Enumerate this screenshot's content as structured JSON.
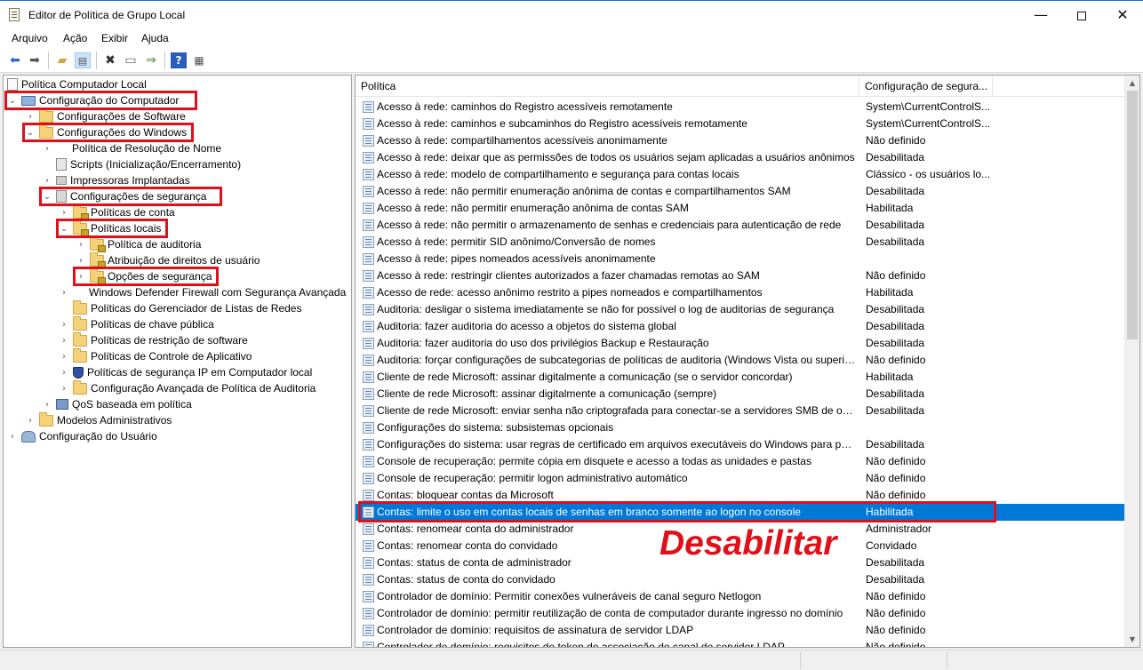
{
  "window": {
    "title": "Editor de Política de Grupo Local",
    "icon": "policy-document-icon"
  },
  "menu": [
    "Arquivo",
    "Ação",
    "Exibir",
    "Ajuda"
  ],
  "toolbar_icons": [
    "back-arrow-icon",
    "forward-arrow-icon",
    "up-folder-icon",
    "show-hide-tree-icon",
    "delete-icon",
    "properties-icon",
    "export-list-icon",
    "help-icon",
    "view-icon"
  ],
  "tree": [
    {
      "label": "Política Computador Local",
      "expander": "",
      "icon": "policy-icon"
    },
    {
      "label": "Configuração do Computador",
      "expander": "open",
      "icon": "computer-icon"
    },
    {
      "label": "Configurações de Software",
      "expander": "closed",
      "icon": "folder-icon"
    },
    {
      "label": "Configurações do Windows",
      "expander": "open",
      "icon": "folder-icon"
    },
    {
      "label": "Política de Resolução de Nome",
      "expander": "closed",
      "icon": ""
    },
    {
      "label": "Scripts (Inicialização/Encerramento)",
      "expander": "",
      "icon": "script-icon"
    },
    {
      "label": "Impressoras Implantadas",
      "expander": "closed",
      "icon": "printer-icon"
    },
    {
      "label": "Configurações de segurança",
      "expander": "open",
      "icon": "security-settings-icon"
    },
    {
      "label": "Políticas de conta",
      "expander": "closed",
      "icon": "lock-folder-icon"
    },
    {
      "label": "Políticas locais",
      "expander": "open",
      "icon": "lock-folder-icon"
    },
    {
      "label": "Política de auditoria",
      "expander": "closed",
      "icon": "lock-folder-icon"
    },
    {
      "label": "Atribuição de direitos de usuário",
      "expander": "closed",
      "icon": "lock-folder-icon"
    },
    {
      "label": "Opções de segurança",
      "expander": "closed",
      "icon": "lock-folder-icon"
    },
    {
      "label": "Windows Defender Firewall com Segurança Avançada",
      "expander": "closed",
      "icon": "firewall-icon"
    },
    {
      "label": "Políticas do Gerenciador de Listas de Redes",
      "expander": "",
      "icon": "folder-icon"
    },
    {
      "label": "Políticas de chave pública",
      "expander": "closed",
      "icon": "folder-icon"
    },
    {
      "label": "Políticas de restrição de software",
      "expander": "closed",
      "icon": "folder-icon"
    },
    {
      "label": "Políticas de Controle de Aplicativo",
      "expander": "closed",
      "icon": "folder-icon"
    },
    {
      "label": "Políticas de segurança IP em Computador local",
      "expander": "closed",
      "icon": "ip-security-icon"
    },
    {
      "label": "Configuração Avançada de Política de Auditoria",
      "expander": "closed",
      "icon": "folder-icon"
    },
    {
      "label": "QoS baseada em política",
      "expander": "closed",
      "icon": "qos-chart-icon"
    },
    {
      "label": "Modelos Administrativos",
      "expander": "closed",
      "icon": "folder-icon"
    },
    {
      "label": "Configuração do Usuário",
      "expander": "closed",
      "icon": "users-icon"
    }
  ],
  "list": {
    "columns": [
      "Política",
      "Configuração de segura..."
    ],
    "rows": [
      {
        "name": "Acesso à rede: caminhos do Registro acessíveis remotamente",
        "value": "System\\CurrentControlS..."
      },
      {
        "name": "Acesso à rede: caminhos e subcaminhos do Registro acessíveis remotamente",
        "value": "System\\CurrentControlS..."
      },
      {
        "name": "Acesso à rede: compartilhamentos acessíveis anonimamente",
        "value": "Não definido"
      },
      {
        "name": "Acesso à rede: deixar que as permissões de todos os usuários sejam aplicadas a usuários anônimos",
        "value": "Desabilitada"
      },
      {
        "name": "Acesso à rede: modelo de compartilhamento e segurança para contas locais",
        "value": "Clássico - os usuários lo..."
      },
      {
        "name": "Acesso à rede: não permitir enumeração anônima de contas e compartilhamentos SAM",
        "value": "Desabilitada"
      },
      {
        "name": "Acesso à rede: não permitir enumeração anônima de contas SAM",
        "value": "Habilitada"
      },
      {
        "name": "Acesso à rede: não permitir o armazenamento de senhas e credenciais para autenticação de rede",
        "value": "Desabilitada"
      },
      {
        "name": "Acesso à rede: permitir SID anônimo/Conversão de nomes",
        "value": "Desabilitada"
      },
      {
        "name": "Acesso à rede: pipes nomeados acessíveis anonimamente",
        "value": ""
      },
      {
        "name": "Acesso à rede: restringir clientes autorizados a fazer chamadas remotas ao SAM",
        "value": "Não definido"
      },
      {
        "name": "Acesso de rede: acesso anônimo restrito a pipes nomeados e compartilhamentos",
        "value": "Habilitada"
      },
      {
        "name": "Auditoria: desligar o sistema imediatamente se não for possível o log de auditorias de segurança",
        "value": "Desabilitada"
      },
      {
        "name": "Auditoria: fazer auditoria do acesso a objetos do sistema global",
        "value": "Desabilitada"
      },
      {
        "name": "Auditoria: fazer auditoria do uso dos privilégios Backup e Restauração",
        "value": "Desabilitada"
      },
      {
        "name": "Auditoria: forçar configurações de subcategorias de políticas de auditoria (Windows Vista ou superior...",
        "value": "Não definido"
      },
      {
        "name": "Cliente de rede Microsoft: assinar digitalmente a comunicação (se o servidor concordar)",
        "value": "Habilitada"
      },
      {
        "name": "Cliente de rede Microsoft: assinar digitalmente a comunicação (sempre)",
        "value": "Desabilitada"
      },
      {
        "name": "Cliente de rede Microsoft: enviar senha não criptografada para conectar-se a servidores SMB de outro...",
        "value": "Desabilitada"
      },
      {
        "name": "Configurações do sistema: subsistemas opcionais",
        "value": ""
      },
      {
        "name": "Configurações do sistema: usar regras de certificado em arquivos executáveis do Windows para políti...",
        "value": "Desabilitada"
      },
      {
        "name": "Console de recuperação: permite cópia em disquete e acesso a todas as unidades e pastas",
        "value": "Não definido"
      },
      {
        "name": "Console de recuperação: permitir logon administrativo automático",
        "value": "Não definido"
      },
      {
        "name": "Contas: bloquear contas da Microsoft",
        "value": "Não definido"
      },
      {
        "name": "Contas: limite o uso em contas locais de senhas em branco somente ao logon no console",
        "value": "Habilitada"
      },
      {
        "name": "Contas: renomear conta do administrador",
        "value": "Administrador"
      },
      {
        "name": "Contas: renomear conta do convidado",
        "value": "Convidado"
      },
      {
        "name": "Contas: status de conta de administrador",
        "value": "Desabilitada"
      },
      {
        "name": "Contas: status de conta do convidado",
        "value": "Desabilitada"
      },
      {
        "name": "Controlador de domínio: Permitir conexões vulneráveis de canal seguro Netlogon",
        "value": "Não definido"
      },
      {
        "name": "Controlador de domínio: permitir reutilização de conta de computador durante ingresso no domínio",
        "value": "Não definido"
      },
      {
        "name": "Controlador de domínio: requisitos de assinatura de servidor LDAP",
        "value": "Não definido"
      },
      {
        "name": "Controlador de domínio: requisitos de token de associação de canal de servidor LDAP",
        "value": "Não definido"
      }
    ],
    "selected_index": 24
  },
  "annotation": {
    "text": "Desabilitar",
    "color": "#e0101a"
  },
  "colors": {
    "selection": "#0078d7",
    "highlight_box": "#e0101a"
  }
}
